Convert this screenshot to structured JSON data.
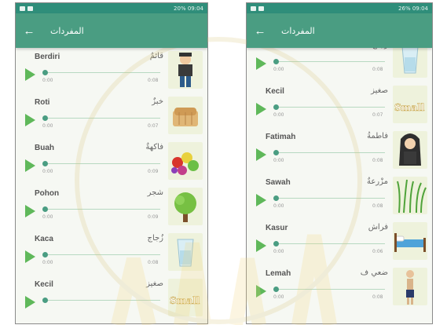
{
  "left": {
    "status": {
      "info": "20% 09:04"
    },
    "appbar": {
      "title": "المفردات"
    },
    "items": [
      {
        "id_word": "Berdiri",
        "ar_word": "قائمٌ",
        "start": "0:00",
        "end": "0:08",
        "image": "standing-boy"
      },
      {
        "id_word": "Roti",
        "ar_word": "خبزٌ",
        "start": "0:00",
        "end": "0:07",
        "image": "bread"
      },
      {
        "id_word": "Buah",
        "ar_word": "فاكهةٌ",
        "start": "0:00",
        "end": "0:09",
        "image": "fruits"
      },
      {
        "id_word": "Pohon",
        "ar_word": "شجر",
        "start": "0:00",
        "end": "0:09",
        "image": "tree"
      },
      {
        "id_word": "Kaca",
        "ar_word": "زُجاج",
        "start": "0:00",
        "end": "0:08",
        "image": "glass"
      },
      {
        "id_word": "Kecil",
        "ar_word": "صغيز",
        "start": "",
        "end": "",
        "image": "small"
      }
    ]
  },
  "right": {
    "status": {
      "info": "26% 09:04"
    },
    "appbar": {
      "title": "المفردات"
    },
    "items": [
      {
        "id_word": "Kaca",
        "ar_word": "زُجاج",
        "start": "0:00",
        "end": "0:08",
        "image": "glass"
      },
      {
        "id_word": "Kecil",
        "ar_word": "صغيز",
        "start": "0:00",
        "end": "0:07",
        "image": "small"
      },
      {
        "id_word": "Fatimah",
        "ar_word": "فاطمةُ",
        "start": "0:00",
        "end": "0:08",
        "image": "girl"
      },
      {
        "id_word": "Sawah",
        "ar_word": "مزْرعةٌ",
        "start": "0:00",
        "end": "0:08",
        "image": "rice-field"
      },
      {
        "id_word": "Kasur",
        "ar_word": "فراش",
        "start": "0:00",
        "end": "0:06",
        "image": "bed"
      },
      {
        "id_word": "Lemah",
        "ar_word": "ضعي ف",
        "start": "0:00",
        "end": "0:08",
        "image": "weak-man"
      }
    ]
  },
  "small_label": "Small",
  "colors": {
    "accent": "#4a9d82",
    "statusbar": "#2f8e7a",
    "play": "#5fb85a"
  }
}
